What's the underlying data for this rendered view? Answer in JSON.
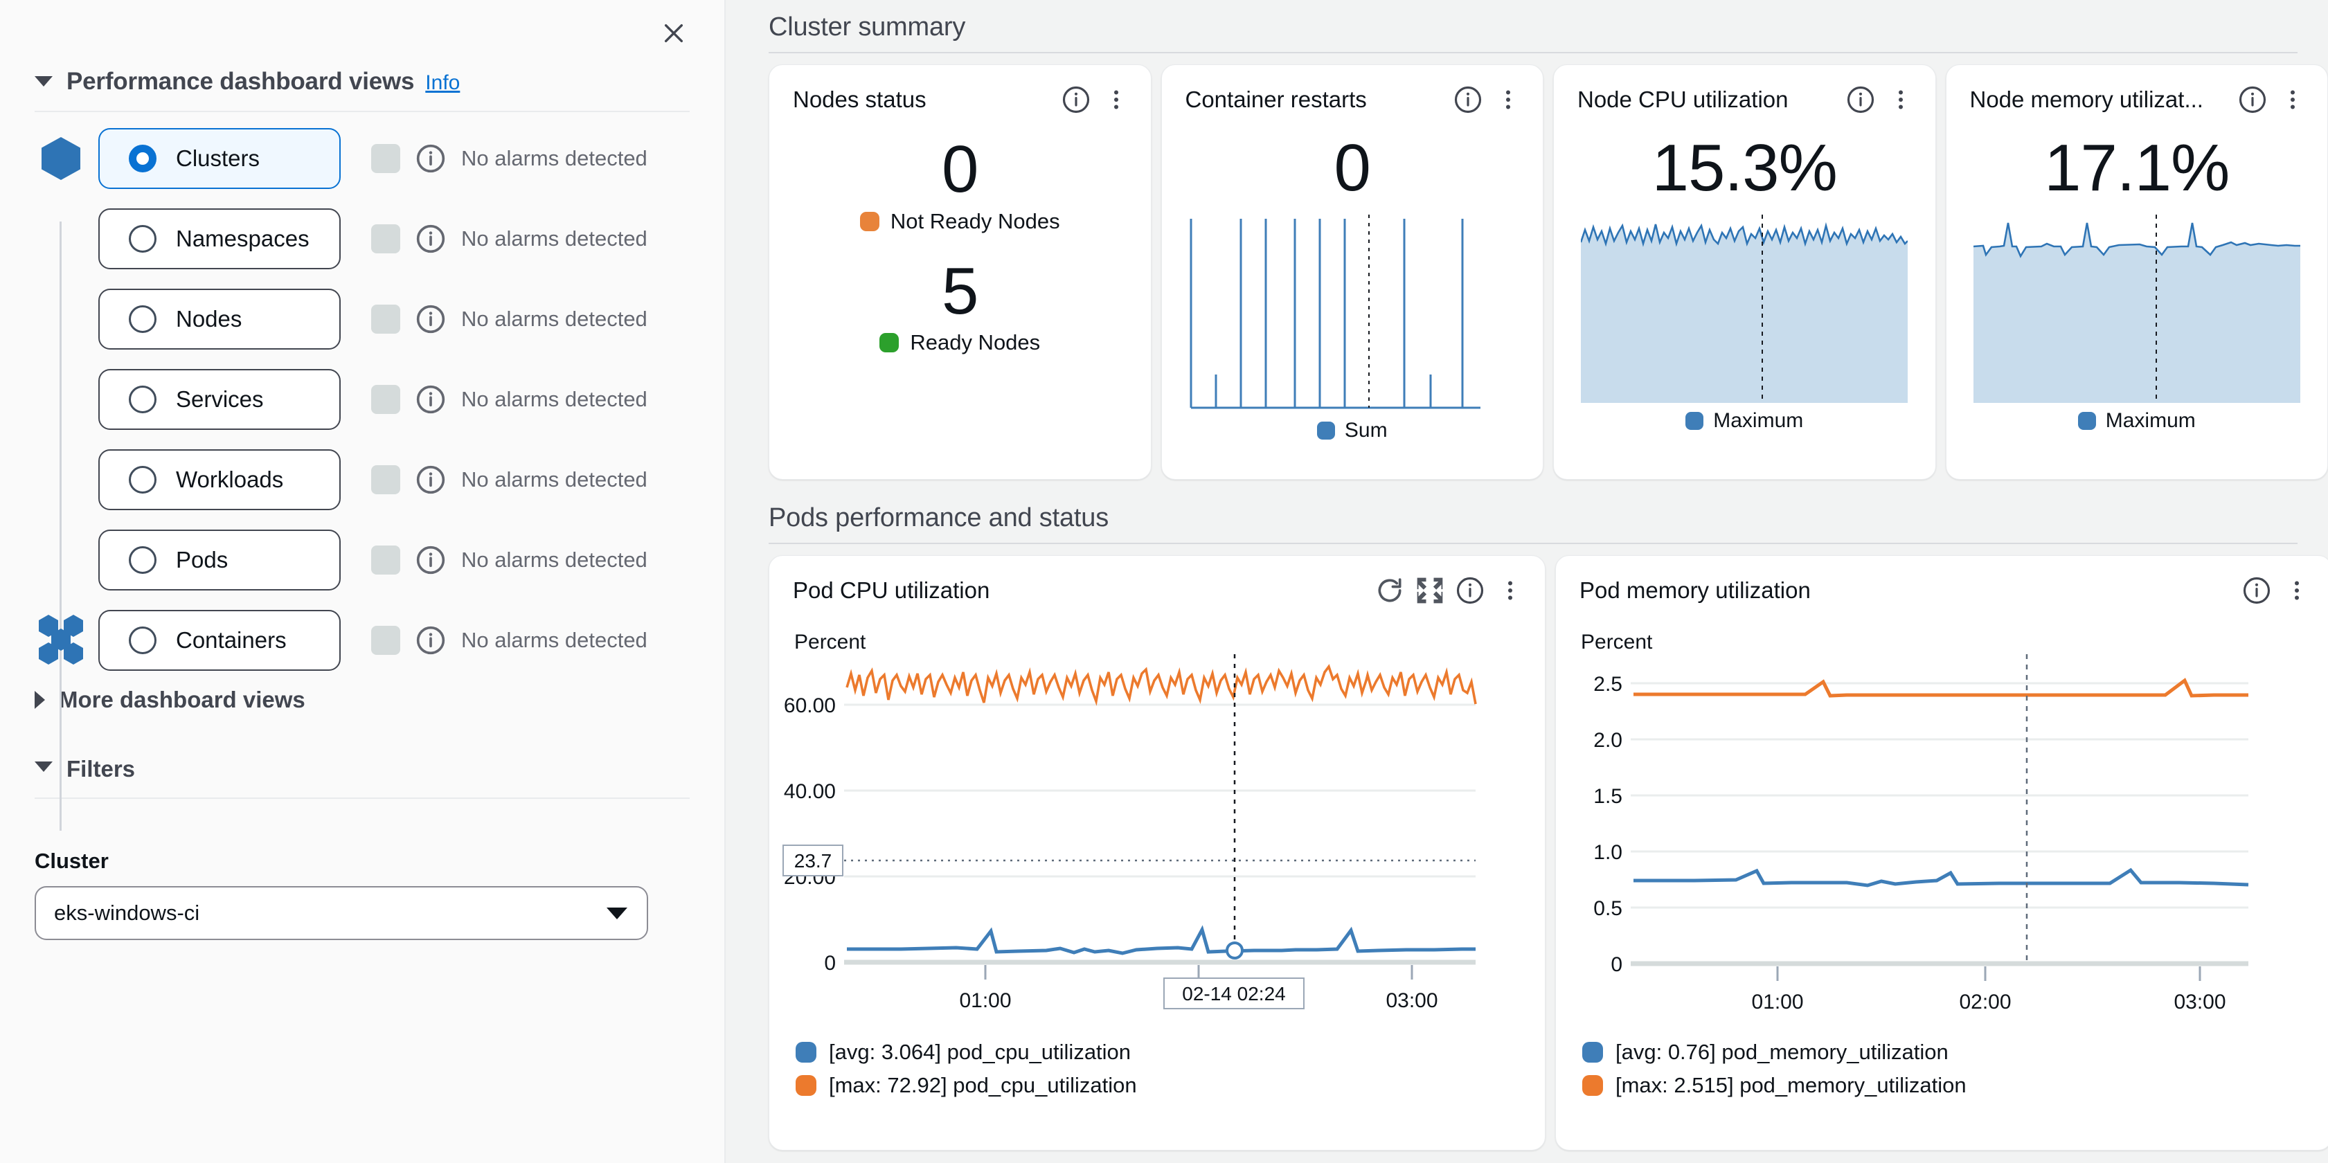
{
  "sidebar": {
    "close_label": "×",
    "section": {
      "title": "Performance dashboard views",
      "info_label": "Info"
    },
    "views": [
      {
        "label": "Clusters",
        "selected": true,
        "alarm": "No alarms detected",
        "icon": "hexagon-icon"
      },
      {
        "label": "Namespaces",
        "selected": false,
        "alarm": "No alarms detected",
        "icon": "none"
      },
      {
        "label": "Nodes",
        "selected": false,
        "alarm": "No alarms detected",
        "icon": "none"
      },
      {
        "label": "Services",
        "selected": false,
        "alarm": "No alarms detected",
        "icon": "none"
      },
      {
        "label": "Workloads",
        "selected": false,
        "alarm": "No alarms detected",
        "icon": "none"
      },
      {
        "label": "Pods",
        "selected": false,
        "alarm": "No alarms detected",
        "icon": "none"
      },
      {
        "label": "Containers",
        "selected": false,
        "alarm": "No alarms detected",
        "icon": "containers-icon"
      }
    ],
    "more_views_label": "More dashboard views",
    "filters_label": "Filters",
    "cluster_filter": {
      "label": "Cluster",
      "value": "eks-windows-ci"
    }
  },
  "cluster_summary": {
    "title": "Cluster summary",
    "cards": [
      {
        "title": "Nodes status",
        "type": "status",
        "values": [
          {
            "number": "0",
            "label": "Not Ready Nodes",
            "color": "#e8833a"
          },
          {
            "number": "5",
            "label": "Ready Nodes",
            "color": "#2ca02c"
          }
        ]
      },
      {
        "title": "Container restarts",
        "type": "sparkline",
        "value": "0",
        "legend": "Sum",
        "legend_color": "#3f7eb8"
      },
      {
        "title": "Node CPU utilization",
        "type": "area",
        "value": "15.3",
        "unit": "%",
        "legend": "Maximum",
        "legend_color": "#3f7eb8"
      },
      {
        "title": "Node memory utilizat...",
        "type": "area",
        "value": "17.1",
        "unit": "%",
        "legend": "Maximum",
        "legend_color": "#3f7eb8"
      }
    ]
  },
  "pods_section": {
    "title": "Pods performance and status"
  },
  "chart_data": [
    {
      "type": "line",
      "title": "Pod CPU utilization",
      "ylabel": "Percent",
      "xlabel": "",
      "yticks": [
        "0",
        "20.00",
        "40.00",
        "60.00"
      ],
      "ytick_values": [
        0,
        20,
        40,
        60
      ],
      "xticks": [
        "01:00",
        "02:00",
        "03:00"
      ],
      "ylim": [
        0,
        80
      ],
      "annotation_label": "23.7",
      "annotation_value": 23.7,
      "crosshair_label": "02-14 02:24",
      "grid": true,
      "legend_position": "bottom",
      "header_icons": [
        "refresh-icon",
        "expand-icon",
        "info-icon",
        "kebab-menu-icon"
      ],
      "series": [
        {
          "name": "[avg: 3.064] pod_cpu_utilization",
          "color": "#3f7eb8",
          "avg": 3.064,
          "approx_values": [
            3.1,
            3.0,
            3.0,
            3.1,
            3.0,
            3.0,
            3.1,
            3.0,
            5.6,
            3.1,
            3.0,
            3.2,
            3.4,
            3.0,
            3.6,
            3.1,
            3.0,
            3.3,
            3.5,
            3.0,
            3.2,
            3.6,
            3.5,
            3.5,
            3.4,
            6.6,
            3.1,
            3.0,
            3.0,
            3.0,
            3.1,
            3.0,
            3.0,
            3.1,
            3.0,
            3.1,
            5.9,
            3.1,
            3.0,
            3.1,
            3.0,
            3.2
          ]
        },
        {
          "name": "[max: 72.92] pod_cpu_utilization",
          "color": "#ec7a2d",
          "max": 72.92,
          "approx_values": [
            68,
            72,
            70,
            71,
            66,
            72,
            69,
            71,
            67,
            70,
            68,
            72,
            66,
            70,
            69,
            71,
            67,
            70,
            64,
            72,
            68,
            70,
            66,
            71,
            69,
            72,
            67,
            70,
            68,
            71,
            65,
            70,
            69,
            72,
            67,
            70,
            68,
            71,
            66,
            72,
            69,
            70,
            67,
            71,
            68,
            72,
            66,
            70,
            69,
            71,
            67,
            70,
            68,
            72,
            66,
            71,
            69,
            70,
            67,
            72,
            68,
            70,
            66,
            71,
            69,
            72,
            67,
            70,
            68,
            71,
            65,
            70,
            69,
            72,
            67,
            70,
            68,
            71,
            66,
            72,
            69,
            70,
            67,
            71,
            68,
            72,
            66,
            70,
            64
          ]
        }
      ]
    },
    {
      "type": "line",
      "title": "Pod memory utilization",
      "ylabel": "Percent",
      "xlabel": "",
      "yticks": [
        "0",
        "0.5",
        "1.0",
        "1.5",
        "2.0",
        "2.5"
      ],
      "ytick_values": [
        0,
        0.5,
        1.0,
        1.5,
        2.0,
        2.5
      ],
      "xticks": [
        "01:00",
        "02:00",
        "03:00"
      ],
      "ylim": [
        0,
        2.8
      ],
      "grid": true,
      "legend_position": "bottom",
      "header_icons": [
        "info-icon",
        "kebab-menu-icon"
      ],
      "series": [
        {
          "name": "[avg: 0.76] pod_memory_utilization",
          "color": "#3f7eb8",
          "avg": 0.76,
          "approx_values": [
            0.76,
            0.76,
            0.76,
            0.76,
            0.76,
            0.76,
            0.76,
            0.76,
            0.76,
            0.79,
            0.86,
            0.77,
            0.76,
            0.76,
            0.76,
            0.76,
            0.76,
            0.76,
            0.77,
            0.79,
            0.76,
            0.78,
            0.8,
            0.78,
            0.76,
            0.77,
            0.79,
            0.87,
            0.77,
            0.76,
            0.76,
            0.76,
            0.76,
            0.76,
            0.76,
            0.76,
            0.76,
            0.76,
            0.76,
            0.78,
            0.88,
            0.78,
            0.77,
            0.77,
            0.77,
            0.76,
            0.75,
            0.75
          ]
        },
        {
          "name": "[max: 2.515] pod_memory_utilization",
          "color": "#ec7a2d",
          "max": 2.515,
          "approx_values": [
            2.4,
            2.4,
            2.4,
            2.4,
            2.4,
            2.4,
            2.4,
            2.4,
            2.4,
            2.4,
            2.4,
            2.4,
            2.51,
            2.41,
            2.4,
            2.4,
            2.4,
            2.4,
            2.4,
            2.4,
            2.4,
            2.4,
            2.4,
            2.4,
            2.4,
            2.4,
            2.4,
            2.4,
            2.4,
            2.4,
            2.4,
            2.4,
            2.4,
            2.4,
            2.4,
            2.4,
            2.4,
            2.51,
            2.41,
            2.4,
            2.4,
            2.4,
            2.4,
            2.4
          ]
        }
      ]
    }
  ],
  "colors": {
    "accent": "#0972d3",
    "blue_series": "#3f7eb8",
    "orange_series": "#ec7a2d",
    "green": "#2ca02c",
    "orange_status": "#e8833a",
    "area_fill": "#c8dcec"
  }
}
